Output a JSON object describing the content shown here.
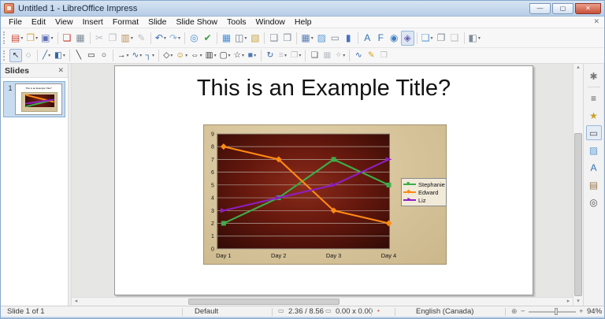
{
  "window": {
    "title": "Untitled 1 - LibreOffice Impress",
    "controls": [
      {
        "name": "minimize-button",
        "glyph": "—"
      },
      {
        "name": "maximize-button",
        "glyph": "▢"
      },
      {
        "name": "close-button",
        "glyph": "✕"
      }
    ],
    "close_document_glyph": "✕"
  },
  "menu": {
    "items": [
      "File",
      "Edit",
      "View",
      "Insert",
      "Format",
      "Slide",
      "Slide Show",
      "Tools",
      "Window",
      "Help"
    ]
  },
  "toolbar_main": {
    "icons": [
      {
        "n": "new-document-icon",
        "g": "▤",
        "c": "#cc4b3c",
        "d": 1
      },
      {
        "n": "open-folder-icon",
        "g": "❒",
        "c": "#d9a33e",
        "d": 1
      },
      {
        "n": "save-icon",
        "g": "▣",
        "c": "#5f6fb8",
        "d": 1
      },
      {
        "n": "export-pdf-icon",
        "g": "❏",
        "c": "#c0392b",
        "s": 1
      },
      {
        "n": "print-icon",
        "g": "▦",
        "c": "#7f8c99"
      },
      {
        "n": "cut-icon",
        "g": "✂",
        "c": "#888",
        "x": 1,
        "s": 1
      },
      {
        "n": "copy-icon",
        "g": "❐",
        "c": "#888",
        "x": 1
      },
      {
        "n": "paste-icon",
        "g": "▥",
        "c": "#ba9056",
        "d": 1
      },
      {
        "n": "clone-formatting-icon",
        "g": "✎",
        "c": "#888",
        "x": 1
      },
      {
        "n": "undo-icon",
        "g": "↶",
        "c": "#3b6fb5",
        "d": 1,
        "s": 1
      },
      {
        "n": "redo-icon",
        "g": "↷",
        "c": "#8fb0d9",
        "d": 1
      },
      {
        "n": "find-replace-icon",
        "g": "◎",
        "c": "#4a90d9",
        "s": 1
      },
      {
        "n": "spelling-icon",
        "g": "✔",
        "c": "#3f9c46"
      },
      {
        "n": "display-grid-icon",
        "g": "▦",
        "c": "#4a90d9",
        "s": 1
      },
      {
        "n": "display-views-icon",
        "g": "◫",
        "c": "#6b7c8f",
        "d": 1
      },
      {
        "n": "master-slide-icon",
        "g": "▧",
        "c": "#c9a53f"
      },
      {
        "n": "slide-properties-icon",
        "g": "❑",
        "c": "#7f8c99",
        "s": 1
      },
      {
        "n": "header-footer-icon",
        "g": "❒",
        "c": "#7f8c99"
      },
      {
        "n": "insert-table-icon",
        "g": "▦",
        "c": "#5b7fb5",
        "d": 1,
        "s": 1
      },
      {
        "n": "insert-image-icon",
        "g": "▨",
        "c": "#5b9bd5"
      },
      {
        "n": "insert-text-frame-icon",
        "g": "▭",
        "c": "#7f8c99"
      },
      {
        "n": "insert-chart-icon",
        "g": "▮",
        "c": "#4472c4"
      },
      {
        "n": "insert-text-box-icon",
        "g": "A",
        "c": "#2e74b5",
        "s": 1
      },
      {
        "n": "fontwork-icon",
        "g": "F",
        "c": "#2e74b5"
      },
      {
        "n": "hyperlink-icon",
        "g": "◉",
        "c": "#3f7fbf"
      },
      {
        "n": "show-draw-functions-icon",
        "g": "◈",
        "c": "#6a5fb0",
        "p": 1
      },
      {
        "n": "new-slide-icon",
        "g": "❏",
        "c": "#5b9bd5",
        "d": 1,
        "s": 1
      },
      {
        "n": "duplicate-slide-icon",
        "g": "❐",
        "c": "#7f8c99"
      },
      {
        "n": "delete-slide-icon",
        "g": "❑",
        "c": "#888",
        "x": 1
      },
      {
        "n": "slide-layout-icon",
        "g": "◧",
        "c": "#7f8c99",
        "d": 1,
        "s": 1
      }
    ]
  },
  "toolbar_drawing": {
    "icons": [
      {
        "n": "select-icon",
        "g": "↖",
        "c": "#333333",
        "p": 1
      },
      {
        "n": "zoom-icon",
        "g": "◌",
        "c": "#555555"
      },
      {
        "n": "line-color-icon",
        "g": "╱",
        "c": "#3465a4",
        "d": 1,
        "s": 1
      },
      {
        "n": "fill-color-icon",
        "g": "◧",
        "c": "#3465a4",
        "d": 1
      },
      {
        "n": "insert-line-icon",
        "g": "╲",
        "c": "#333333",
        "s": 1
      },
      {
        "n": "rectangle-icon",
        "g": "▭",
        "c": "#333333"
      },
      {
        "n": "ellipse-icon",
        "g": "○",
        "c": "#333333"
      },
      {
        "n": "lines-arrows-icon",
        "g": "→",
        "c": "#333333",
        "d": 1,
        "s": 1
      },
      {
        "n": "curve-icon",
        "g": "∿",
        "c": "#3465a4",
        "d": 1
      },
      {
        "n": "connector-icon",
        "g": "┐",
        "c": "#3465a4",
        "d": 1
      },
      {
        "n": "basic-shapes-icon",
        "g": "◇",
        "c": "#333333",
        "d": 1,
        "s": 1
      },
      {
        "n": "symbol-shapes-icon",
        "g": "☺",
        "c": "#b58900",
        "d": 1
      },
      {
        "n": "block-arrows-icon",
        "g": "⇔",
        "c": "#333333",
        "d": 1
      },
      {
        "n": "flowchart-icon",
        "g": "▥",
        "c": "#333333",
        "d": 1
      },
      {
        "n": "callouts-icon",
        "g": "▢",
        "c": "#333333",
        "d": 1
      },
      {
        "n": "stars-icon",
        "g": "☆",
        "c": "#333333",
        "d": 1
      },
      {
        "n": "3d-objects-icon",
        "g": "■",
        "c": "#4a7ab5",
        "d": 1
      },
      {
        "n": "rotate-icon",
        "g": "↻",
        "c": "#3465a4",
        "s": 1
      },
      {
        "n": "align-objects-icon",
        "g": "≡",
        "c": "#888",
        "x": 1,
        "d": 1
      },
      {
        "n": "arrange-icon",
        "g": "❐",
        "c": "#888",
        "x": 1,
        "d": 1
      },
      {
        "n": "shadow-icon",
        "g": "❏",
        "c": "#555555",
        "s": 1
      },
      {
        "n": "crop-image-icon",
        "g": "▦",
        "c": "#888",
        "x": 1
      },
      {
        "n": "image-filter-icon",
        "g": "✧",
        "c": "#888",
        "x": 1,
        "d": 1
      },
      {
        "n": "edit-points-icon",
        "g": "∿",
        "c": "#3465a4",
        "s": 1
      },
      {
        "n": "glue-points-icon",
        "g": "✎",
        "c": "#d4a017"
      },
      {
        "n": "display-in-front-icon",
        "g": "❒",
        "c": "#888",
        "x": 1
      }
    ]
  },
  "slides_panel": {
    "title": "Slides",
    "close_glyph": "✕",
    "slide_number": "1"
  },
  "slide": {
    "title": "This is an Example Title?"
  },
  "chart_data": {
    "type": "line",
    "categories": [
      "Day 1",
      "Day 2",
      "Day 3",
      "Day 4"
    ],
    "series": [
      {
        "name": "Stephanie",
        "color": "#3cae4a",
        "marker": "square",
        "values": [
          2,
          4,
          7,
          5
        ]
      },
      {
        "name": "Edward",
        "color": "#ff8a12",
        "marker": "diamond",
        "values": [
          8,
          7,
          3,
          2
        ]
      },
      {
        "name": "Liz",
        "color": "#8d1fc0",
        "marker": "arrow",
        "values": [
          3,
          4,
          5,
          7
        ]
      }
    ],
    "xlabel": "",
    "ylabel": "",
    "ylim": [
      0,
      9
    ],
    "yticks": [
      0,
      1,
      2,
      3,
      4,
      5,
      6,
      7,
      8,
      9
    ],
    "grid": "horizontal",
    "legend_position": "right",
    "plot_background": "dark-red radial gradient",
    "chart_background": "parchment tan"
  },
  "sidebar": {
    "icons": [
      {
        "n": "sidebar-settings-icon",
        "g": "✱",
        "c": "#777777"
      },
      {
        "n": "properties-icon",
        "g": "≡",
        "c": "#555555"
      },
      {
        "n": "slide-transition-icon",
        "g": "★",
        "c": "#c9a227"
      },
      {
        "n": "master-slides-icon",
        "g": "▭",
        "c": "#555555",
        "p": 1
      },
      {
        "n": "animation-icon",
        "g": "▨",
        "c": "#5b9bd5"
      },
      {
        "n": "styles-icon",
        "g": "A",
        "c": "#2e74b5"
      },
      {
        "n": "gallery-icon",
        "g": "▤",
        "c": "#9c7b4f"
      },
      {
        "n": "navigator-icon",
        "g": "◎",
        "c": "#555555"
      }
    ]
  },
  "status": {
    "slide_info": "Slide 1 of 1",
    "template": "Default",
    "position": "2.36 / 8.56",
    "size": "0.00 x 0.00",
    "language": "English (Canada)",
    "zoom": "94%"
  }
}
